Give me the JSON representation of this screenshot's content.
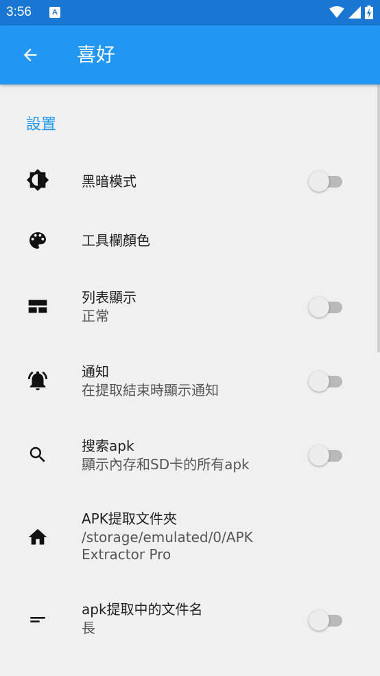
{
  "status_bar": {
    "time": "3:56",
    "notification_icon": "a-icon",
    "notification_glyph": "A",
    "wifi_icon": "wifi-icon",
    "signal_icon": "signal-icon",
    "battery_icon": "battery-charging-icon"
  },
  "app_bar": {
    "back_icon": "arrow-back-icon",
    "title": "喜好",
    "background": "#2196f3"
  },
  "section": {
    "title": "設置"
  },
  "preferences": [
    {
      "icon": "brightness-icon",
      "title": "黑暗模式",
      "summary": "",
      "has_switch": true,
      "checked": false
    },
    {
      "icon": "palette-icon",
      "title": "工具欄顏色",
      "summary": "",
      "has_switch": false
    },
    {
      "icon": "list-view-icon",
      "title": "列表顯示",
      "summary": "正常",
      "has_switch": true,
      "checked": false
    },
    {
      "icon": "bell-icon",
      "title": "通知",
      "summary": "在提取結束時顯示通知",
      "has_switch": true,
      "checked": false
    },
    {
      "icon": "search-icon",
      "title": "搜索apk",
      "summary": "顯示內存和SD卡的所有apk",
      "has_switch": true,
      "checked": false
    },
    {
      "icon": "home-icon",
      "title": "APK提取文件夾",
      "summary": "/storage/emulated/0/APK Extractor Pro",
      "has_switch": false
    },
    {
      "icon": "short-text-icon",
      "title": "apk提取中的文件名",
      "summary": "長",
      "has_switch": true,
      "checked": false
    }
  ],
  "colors": {
    "status_bar": "#1976d2",
    "accent": "#2196f3",
    "background": "#f0f0f0"
  }
}
